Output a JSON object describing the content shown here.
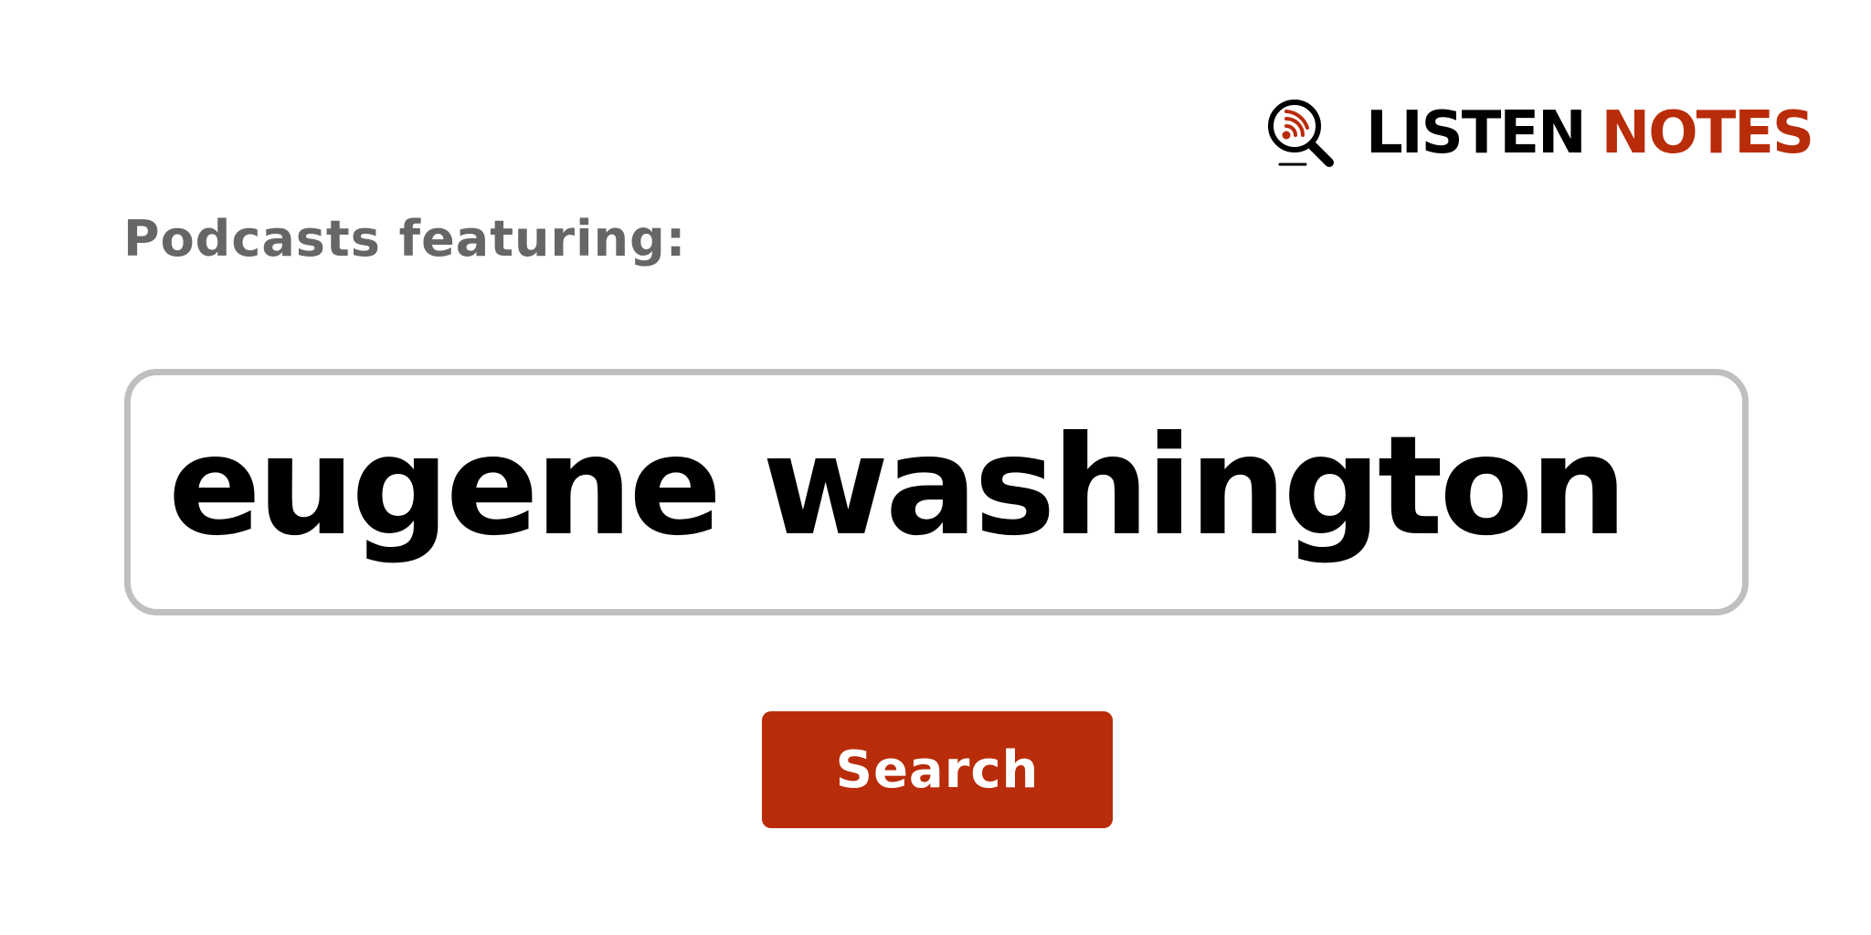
{
  "brand": {
    "name_part1": "LISTEN",
    "name_part2": "NOTES",
    "icon": "magnifier-rss-icon",
    "color_primary": "#000000",
    "color_accent": "#b92c09"
  },
  "subtitle": "Podcasts featuring:",
  "search": {
    "value": "eugene washington",
    "border_color": "#bfbfbf"
  },
  "button": {
    "label": "Search",
    "color": "#b92c09"
  }
}
